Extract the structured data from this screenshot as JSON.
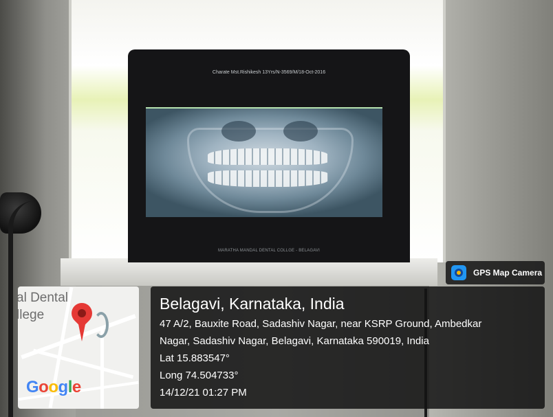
{
  "xray": {
    "header": "Charate Mst.Rishikesh 13Yrs/N-3569/M/18-Oct-2016",
    "footer": "MARATHA MANDAL DENTAL COLLGE - BELAGAVI"
  },
  "map": {
    "label_line1": "al Dental",
    "label_line2": "llege",
    "logo_letters": [
      "G",
      "o",
      "o",
      "g",
      "l",
      "e"
    ],
    "logo_colors": [
      "#4285F4",
      "#EA4335",
      "#FBBC05",
      "#4285F4",
      "#34A853",
      "#EA4335"
    ],
    "pin_color": "#e53935"
  },
  "gps_badge": {
    "label": "GPS Map Camera",
    "icon": "gps-map-camera-icon"
  },
  "location": {
    "title": "Belagavi, Karnataka, India",
    "address_line1": "47 A/2, Bauxite Road, Sadashiv Nagar, near KSRP Ground, Ambedkar",
    "address_line2": "Nagar, Sadashiv Nagar, Belagavi, Karnataka 590019, India",
    "lat": "Lat 15.883547°",
    "long": "Long 74.504733°",
    "datetime": "14/12/21 01:27 PM"
  }
}
